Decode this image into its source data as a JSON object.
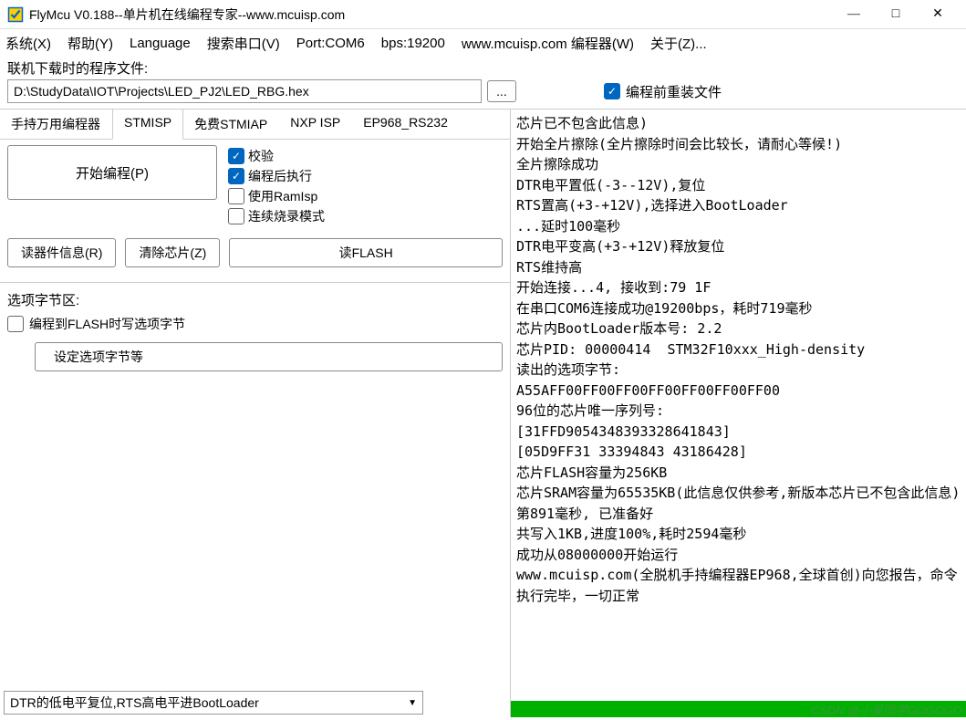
{
  "title": "FlyMcu V0.188--单片机在线编程专家--www.mcuisp.com",
  "menu": {
    "system": "系统(X)",
    "help": "帮助(Y)",
    "language": "Language",
    "search_port": "搜索串口(V)",
    "port": "Port:COM6",
    "bps": "bps:19200",
    "website": "www.mcuisp.com 编程器(W)",
    "about": "关于(Z)..."
  },
  "file": {
    "label": "联机下载时的程序文件:",
    "path": "D:\\StudyData\\IOT\\Projects\\LED_PJ2\\LED_RBG.hex",
    "browse": "...",
    "reload": "编程前重装文件"
  },
  "tabs": {
    "t0": "手持万用编程器",
    "t1": "STMISP",
    "t2": "免费STMIAP",
    "t3": "NXP ISP",
    "t4": "EP968_RS232"
  },
  "prog": {
    "start": "开始编程(P)",
    "verify": "校验",
    "run_after": "编程后执行",
    "use_ramisp": "使用RamIsp",
    "continuous": "连续烧录模式"
  },
  "buttons": {
    "read_info": "读器件信息(R)",
    "erase": "清除芯片(Z)",
    "read_flash": "读FLASH"
  },
  "options": {
    "section": "选项字节区:",
    "write_opt": "编程到FLASH时写选项字节",
    "set_opt": "设定选项字节等"
  },
  "combo": {
    "value": "DTR的低电平复位,RTS高电平进BootLoader"
  },
  "log_lines": [
    "芯片已不包含此信息)",
    "开始全片擦除(全片擦除时间会比较长，请耐心等候!)",
    "全片擦除成功",
    "DTR电平置低(-3--12V),复位",
    "RTS置高(+3-+12V),选择进入BootLoader",
    "...延时100毫秒",
    "DTR电平变高(+3-+12V)释放复位",
    "RTS维持高",
    "开始连接...4, 接收到:79 1F",
    "在串口COM6连接成功@19200bps，耗时719毫秒",
    "芯片内BootLoader版本号: 2.2",
    "芯片PID: 00000414  STM32F10xxx_High-density",
    "读出的选项字节:",
    "A55AFF00FF00FF00FF00FF00FF00FF00",
    "96位的芯片唯一序列号:",
    "[31FFD9054348393328641843]",
    "[05D9FF31 33394843 43186428]",
    "芯片FLASH容量为256KB",
    "芯片SRAM容量为65535KB(此信息仅供参考,新版本芯片已不包含此信息)",
    "第891毫秒, 已准备好",
    "共写入1KB,进度100%,耗时2594毫秒",
    "成功从08000000开始运行",
    "www.mcuisp.com(全脱机手持编程器EP968,全球首创)向您报告，命令执行完毕，一切正常"
  ],
  "watermark": "CSDN @小吴同学GOGOGO"
}
